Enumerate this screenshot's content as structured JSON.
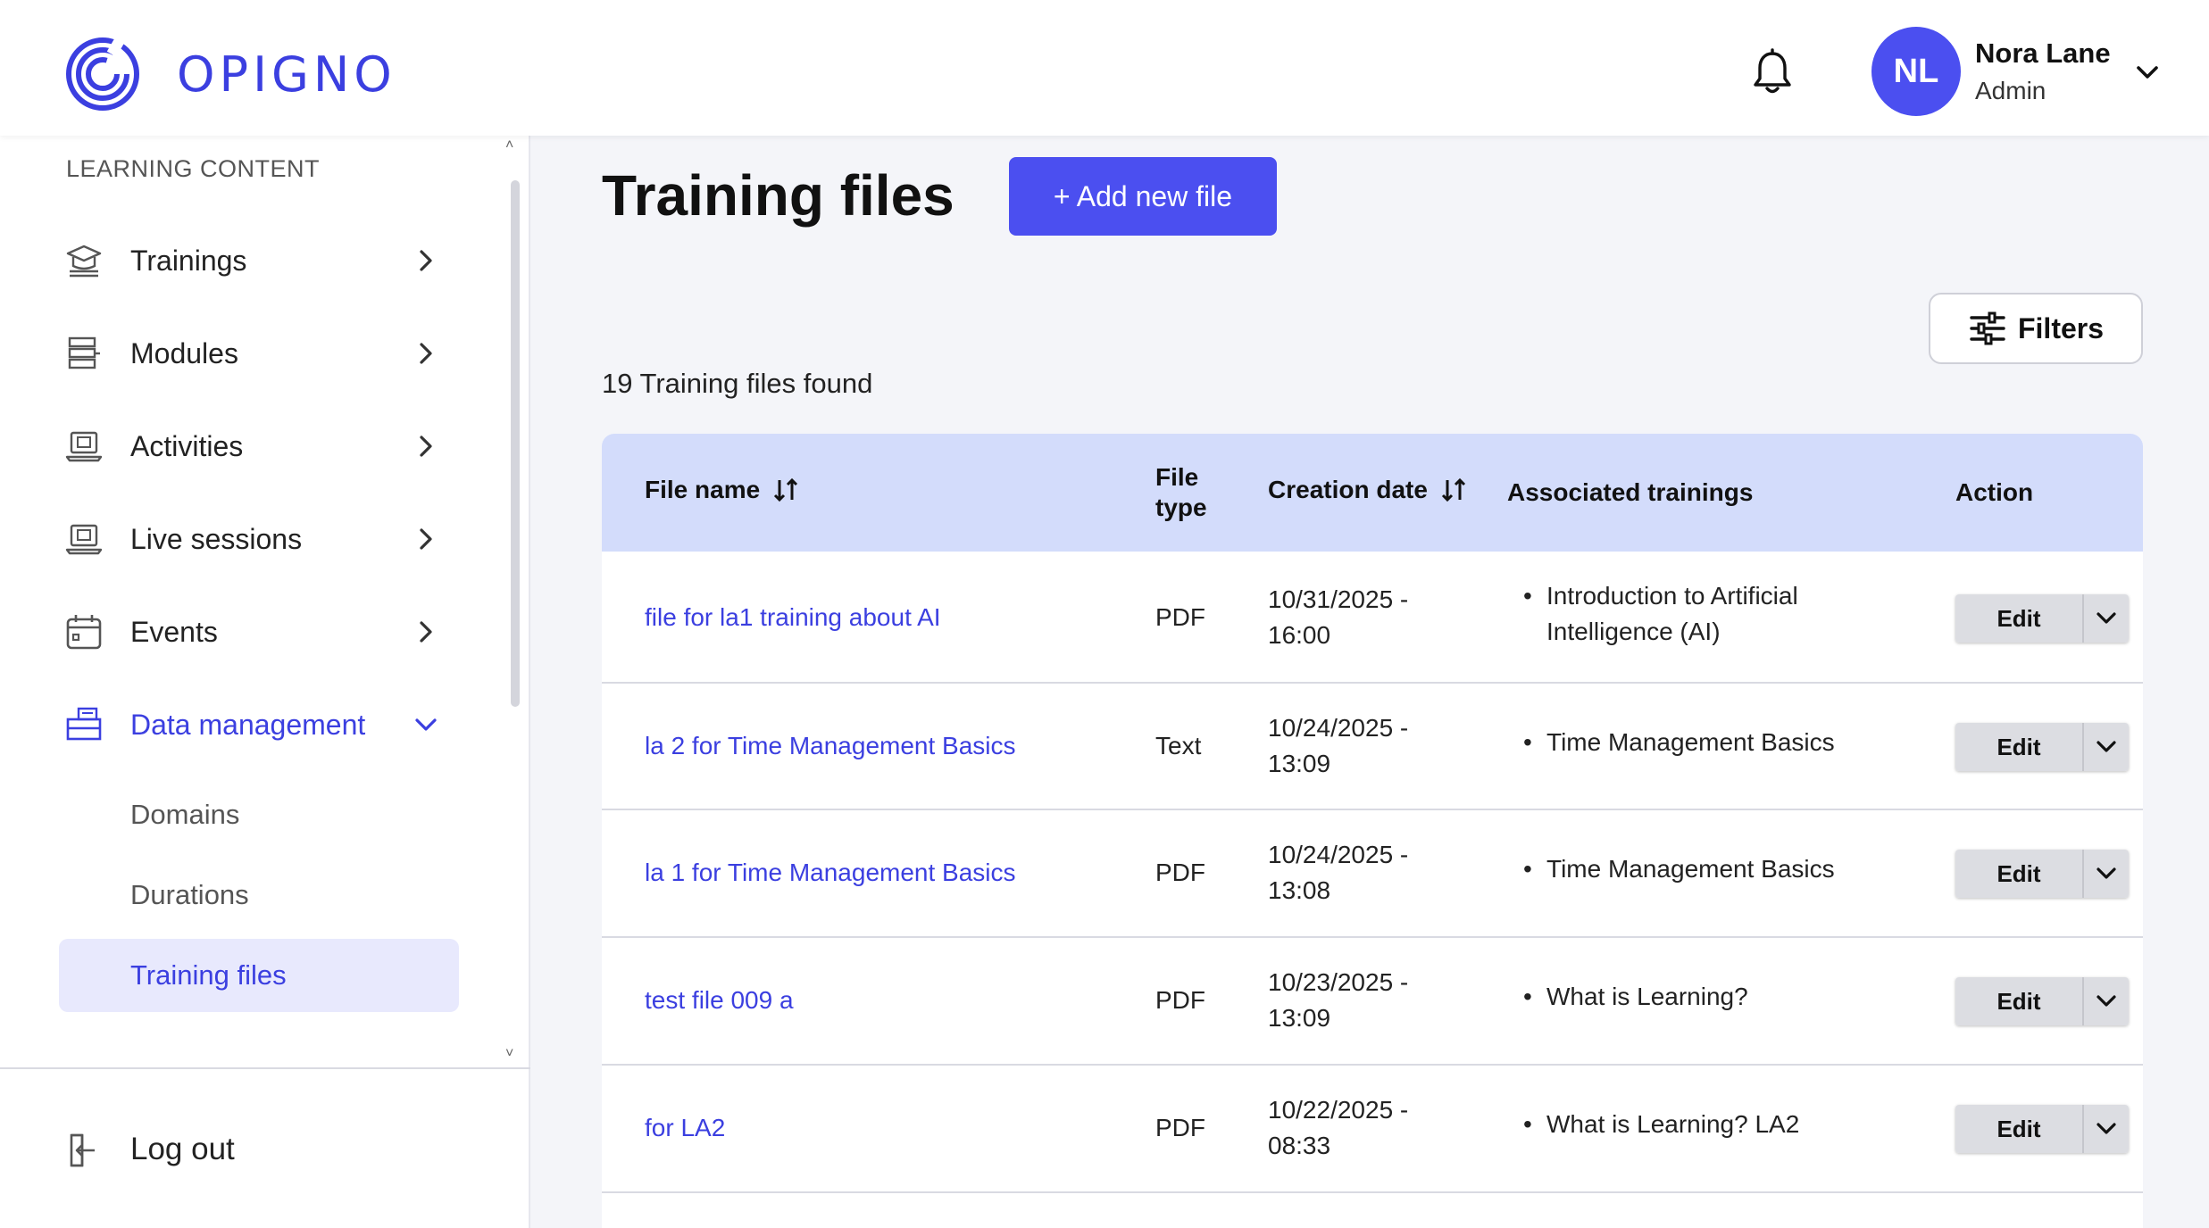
{
  "header": {
    "brand": "OPIGNO",
    "user": {
      "initials": "NL",
      "name": "Nora Lane",
      "role": "Admin"
    },
    "brand_color": "#3b3fe0"
  },
  "sidebar": {
    "section_label": "LEARNING CONTENT",
    "items": [
      {
        "label": "Trainings",
        "icon": "graduation-cap-icon"
      },
      {
        "label": "Modules",
        "icon": "modules-icon"
      },
      {
        "label": "Activities",
        "icon": "laptop-icon"
      },
      {
        "label": "Live sessions",
        "icon": "laptop-icon"
      },
      {
        "label": "Events",
        "icon": "calendar-icon"
      },
      {
        "label": "Data management",
        "icon": "data-management-icon",
        "expanded": true
      }
    ],
    "subitems": [
      {
        "label": "Domains"
      },
      {
        "label": "Durations"
      },
      {
        "label": "Training files",
        "active": true
      }
    ],
    "logout_label": "Log out"
  },
  "main": {
    "title": "Training files",
    "add_button": "+ Add new file",
    "filters_button": "Filters",
    "found_text": "19 Training files found",
    "table": {
      "headers": {
        "file_name": "File name",
        "file_type_1": "File",
        "file_type_2": "type",
        "creation_date": "Creation date",
        "associated": "Associated trainings",
        "action": "Action"
      },
      "rows": [
        {
          "name": "file for la1 training about AI",
          "type": "PDF",
          "date1": "10/31/2025 -",
          "date2": "16:00",
          "trainings": [
            "Introduction to Artificial",
            "Intelligence (AI)"
          ],
          "edit": "Edit"
        },
        {
          "name": "la 2 for Time Management Basics",
          "type": "Text",
          "date1": "10/24/2025 -",
          "date2": "13:09",
          "trainings": [
            "Time Management Basics"
          ],
          "edit": "Edit"
        },
        {
          "name": "la 1 for Time Management Basics",
          "type": "PDF",
          "date1": "10/24/2025 -",
          "date2": "13:08",
          "trainings": [
            "Time Management Basics"
          ],
          "edit": "Edit"
        },
        {
          "name": "test file 009 a",
          "type": "PDF",
          "date1": "10/23/2025 -",
          "date2": "13:09",
          "trainings": [
            "What is Learning?"
          ],
          "edit": "Edit"
        },
        {
          "name": "for LA2",
          "type": "PDF",
          "date1": "10/22/2025 -",
          "date2": "08:33",
          "trainings": [
            "What is Learning? LA2"
          ],
          "edit": "Edit"
        }
      ]
    }
  }
}
